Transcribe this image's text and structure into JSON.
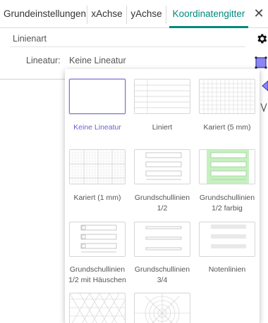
{
  "tabs": [
    {
      "label": "Grundeinstellungen",
      "active": false
    },
    {
      "label": "xAchse",
      "active": false
    },
    {
      "label": "yAchse",
      "active": false
    },
    {
      "label": "Koordinatengitter",
      "active": true
    }
  ],
  "close_icon": "close-icon",
  "section": {
    "title": "Linienart",
    "field_label": "Lineatur:",
    "field_value": "Keine Lineatur"
  },
  "side_icons": [
    "gear-icon",
    "polygon-tool-icon",
    "triangle-tool-icon",
    "vector-tool-icon"
  ],
  "accent_color": "#00897b",
  "selected_color": "#7b74d9",
  "options": [
    {
      "label": "Keine Lineatur",
      "selected": true
    },
    {
      "label": "Liniert",
      "selected": false
    },
    {
      "label": "Kariert (5 mm)",
      "selected": false
    },
    {
      "label": "Kariert (1 mm)",
      "selected": false
    },
    {
      "label": "Grundschullinien 1/2",
      "selected": false
    },
    {
      "label": "Grundschullinien 1/2 farbig",
      "selected": false
    },
    {
      "label": "Grundschullinien 1/2 mit Häuschen",
      "selected": false
    },
    {
      "label": "Grundschullinien 3/4",
      "selected": false
    },
    {
      "label": "Notenlinien",
      "selected": false
    }
  ]
}
